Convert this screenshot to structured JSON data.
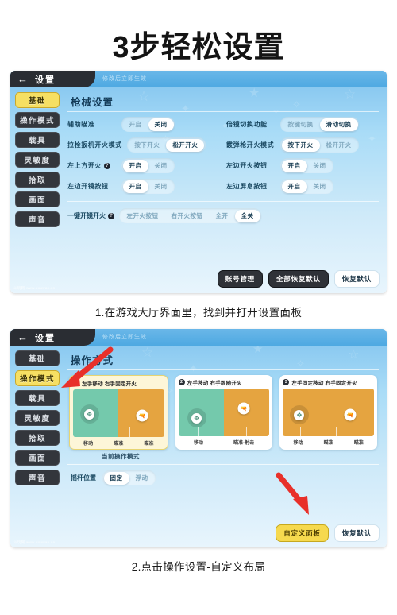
{
  "title": "3步轻松设置",
  "panel1": {
    "back_icon": "back-arrow-icon",
    "window_title": "设置",
    "hint": "修改后立即生效",
    "sidebar": [
      {
        "label": "基础",
        "active": true
      },
      {
        "label": "操作模式",
        "active": false
      },
      {
        "label": "载具",
        "active": false
      },
      {
        "label": "灵敏度",
        "active": false
      },
      {
        "label": "拾取",
        "active": false
      },
      {
        "label": "画面",
        "active": false
      },
      {
        "label": "声音",
        "active": false
      }
    ],
    "section_title": "枪械设置",
    "rows": [
      {
        "left": {
          "label": "辅助瞄准",
          "help": false,
          "options": [
            "开启",
            "关闭"
          ],
          "selected": 1
        },
        "right": {
          "label": "倍镜切换功能",
          "help": false,
          "options": [
            "按键切换",
            "滑动切换"
          ],
          "selected": 1
        }
      },
      {
        "left": {
          "label": "拉栓扳机开火模式",
          "help": false,
          "options": [
            "按下开火",
            "松开开火"
          ],
          "selected": 1
        },
        "right": {
          "label": "霰弹枪开火模式",
          "help": false,
          "options": [
            "按下开火",
            "松开开火"
          ],
          "selected": 0
        }
      },
      {
        "left": {
          "label": "左上方开火",
          "help": true,
          "options": [
            "开启",
            "关闭"
          ],
          "selected": 0
        },
        "right": {
          "label": "左边开火按钮",
          "help": false,
          "options": [
            "开启",
            "关闭"
          ],
          "selected": 0
        }
      },
      {
        "left": {
          "label": "左边开镜按钮",
          "help": false,
          "options": [
            "开启",
            "关闭"
          ],
          "selected": 0
        },
        "right": {
          "label": "左边屏息按钮",
          "help": false,
          "options": [
            "开启",
            "关闭"
          ],
          "selected": 0
        }
      }
    ],
    "full_row": {
      "label": "一键开镜开火",
      "help": true,
      "options": [
        "左开火按钮",
        "右开火按钮",
        "全开",
        "全关"
      ],
      "selected": 3
    },
    "footer": [
      {
        "label": "账号管理",
        "style": "dark"
      },
      {
        "label": "全部恢复默认",
        "style": "dark"
      },
      {
        "label": "恢复默认",
        "style": "light"
      }
    ],
    "watermark": "斗玩网 www.douwan.cn"
  },
  "caption1": "1.在游戏大厅界面里，找到并打开设置面板",
  "panel2": {
    "back_icon": "back-arrow-icon",
    "window_title": "设置",
    "hint": "修改后立即生效",
    "sidebar": [
      {
        "label": "基础",
        "active": false
      },
      {
        "label": "操作模式",
        "active": true
      },
      {
        "label": "载具",
        "active": false
      },
      {
        "label": "灵敏度",
        "active": false
      },
      {
        "label": "拾取",
        "active": false
      },
      {
        "label": "画面",
        "active": false
      },
      {
        "label": "声音",
        "active": false
      }
    ],
    "section_title": "操作方式",
    "cards": [
      {
        "num": "1",
        "title": "左手移动 右手固定开火",
        "selected": true,
        "scene": "split",
        "labels": [
          "移动",
          "瞄准",
          "瞄准"
        ]
      },
      {
        "num": "2",
        "title": "左手移动 右手跟随开火",
        "selected": false,
        "scene": "split",
        "labels": [
          "移动",
          "瞄准·射击"
        ]
      },
      {
        "num": "3",
        "title": "左手固定移动 右手固定开火",
        "selected": false,
        "scene": "orange",
        "labels": [
          "移动",
          "瞄准",
          "瞄准"
        ]
      }
    ],
    "current_mode_label": "当前操作模式",
    "stick_row": {
      "label": "摇杆位置",
      "options": [
        "固定",
        "浮动"
      ],
      "selected": 0
    },
    "footer": [
      {
        "label": "自定义面板",
        "style": "yellow"
      },
      {
        "label": "恢复默认",
        "style": "light"
      }
    ],
    "watermark": "斗玩网 www.douwan.cn"
  },
  "caption2": "2.点击操作设置-自定义布局",
  "colors": {
    "accent_yellow": "#f6d94e",
    "panel_blue": "#7fc2ee",
    "dark_button": "#2f3238",
    "arrow_red": "#e8302a",
    "scene_green": "#74c9ac",
    "scene_orange": "#e5a440"
  }
}
